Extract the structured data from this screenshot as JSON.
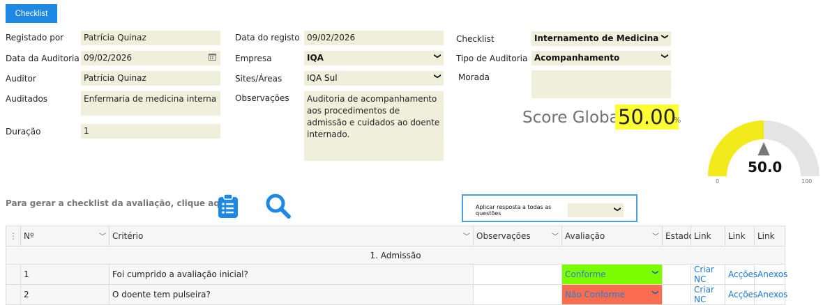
{
  "toolbar": {
    "checklist_button": "Checklist"
  },
  "form": {
    "registado_por": {
      "label": "Registado por",
      "value": "Patrícia Quinaz"
    },
    "data_auditoria": {
      "label": "Data da Auditoria",
      "value": "09/02/2026"
    },
    "auditor": {
      "label": "Auditor",
      "value": "Patrícia Quinaz"
    },
    "auditados": {
      "label": "Auditados",
      "value": "Enfermaria de medicina interna"
    },
    "duracao": {
      "label": "Duração",
      "value": "1"
    },
    "data_registo": {
      "label": "Data do registo",
      "value": "09/02/2026"
    },
    "empresa": {
      "label": "Empresa",
      "value": "IQA"
    },
    "sites": {
      "label": "Sites/Áreas",
      "value": "IQA Sul"
    },
    "observacoes": {
      "label": "Observações",
      "value": "Auditoria de acompanhamento aos procedimentos de admissão e cuidados ao doente internado."
    },
    "checklist": {
      "label": "Checklist",
      "value": "Internamento de Medicina"
    },
    "tipo_auditoria": {
      "label": "Tipo de Auditoria",
      "value": "Acompanhamento"
    },
    "morada": {
      "label": "Morada",
      "value": ""
    }
  },
  "score": {
    "label": "Score Global",
    "value": "50.00",
    "unit": "%",
    "gauge_value": "50.0",
    "gauge_fraction": 0.5,
    "gauge_min": "0",
    "gauge_max": "100",
    "gauge_color": "#f2ea1b",
    "gauge_track_color": "#e4e4e4"
  },
  "generate": {
    "text": "Para gerar a checklist da avaliação, clique aqui:"
  },
  "apply_all": {
    "label": "Aplicar resposta a todas as questões"
  },
  "grid": {
    "headers": [
      "Nº",
      "Critério",
      "Observações",
      "Avaliação",
      "Estado",
      "Link",
      "Link",
      "Link"
    ],
    "section": "1. Admissão",
    "rows": [
      {
        "n": "1",
        "criterio": "Foi cumprido a avaliação inicial?",
        "observacoes": "",
        "avaliacao": "Conforme",
        "estado": "",
        "link1": "Criar NC",
        "link2": "Acções",
        "link3": "Anexos"
      },
      {
        "n": "2",
        "criterio": "O doente tem pulseira?",
        "observacoes": "",
        "avaliacao": "Não Conforme",
        "estado": "",
        "link1": "Criar NC",
        "link2": "Acções",
        "link3": "Anexos"
      }
    ]
  },
  "colors": {
    "primary": "#1e88e5",
    "field_bg": "#efefdc",
    "conforme": "#7dfc00",
    "nao_conforme": "#fa6e4f",
    "section_bg": "#d3f2fb"
  }
}
